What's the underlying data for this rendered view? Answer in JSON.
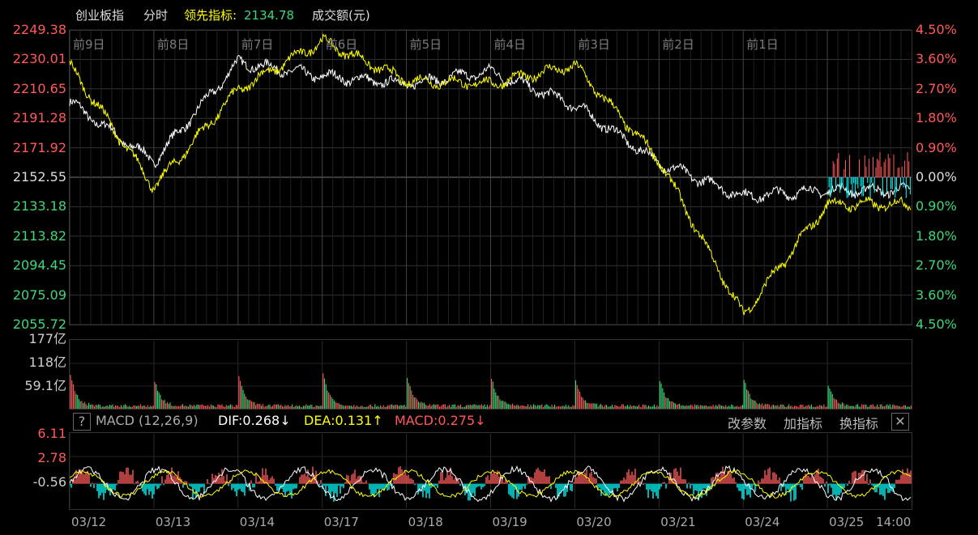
{
  "header": {
    "index_name": "创业板指",
    "mode": "分时",
    "lead_label": "领先指标:",
    "lead_value": "2134.78",
    "volume_label": "成交额(元)"
  },
  "colors": {
    "up": "#ff5a5a",
    "down": "#3fd77a",
    "price": "#ffffff",
    "lead": "#ffff00",
    "cyan": "#00ffff",
    "grid": "#333333",
    "dayline": "#444444"
  },
  "price_axis": {
    "left_ticks": [
      "2249.38",
      "2230.01",
      "2210.65",
      "2191.28",
      "2171.92",
      "2152.55",
      "2133.18",
      "2113.82",
      "2094.45",
      "2075.09",
      "2055.72"
    ],
    "right_ticks": [
      "4.50%",
      "3.60%",
      "2.70%",
      "1.80%",
      "0.90%",
      "0.00%",
      "0.90%",
      "1.80%",
      "2.70%",
      "3.60%",
      "4.50%"
    ]
  },
  "day_labels": [
    "前9日",
    "前8日",
    "前7日",
    "前6日",
    "前5日",
    "前4日",
    "前3日",
    "前2日",
    "前1日"
  ],
  "volume_axis": {
    "ticks": [
      "177亿",
      "118亿",
      "59.1亿"
    ]
  },
  "macd_header": {
    "help": "?",
    "name": "MACD (12,26,9)",
    "dif": "DIF:0.268↓",
    "dea": "DEA:0.131↑",
    "macd": "MACD:0.275↓",
    "btn_params": "改参数",
    "btn_add": "加指标",
    "btn_switch": "换指标",
    "btn_close": "✕"
  },
  "macd_axis": {
    "ticks": [
      "6.11",
      "2.78",
      "-0.56"
    ]
  },
  "date_labels": [
    "03/12",
    "03/13",
    "03/14",
    "03/17",
    "03/18",
    "03/19",
    "03/20",
    "03/21",
    "03/24",
    "03/25",
    "14:00"
  ],
  "chart_data": {
    "type": "line",
    "title": "创业板指 分时",
    "x": [
      "03/12",
      "03/13",
      "03/14",
      "03/17",
      "03/18",
      "03/19",
      "03/20",
      "03/21",
      "03/24",
      "03/25"
    ],
    "series": [
      {
        "name": "创业板指",
        "values": [
          2202.0,
          2163.0,
          2228.0,
          2219.0,
          2214.0,
          2222.0,
          2200.0,
          2162.0,
          2140.0,
          2144.0
        ]
      },
      {
        "name": "领先指标",
        "values": [
          2226.0,
          2146.0,
          2210.0,
          2242.0,
          2216.0,
          2214.0,
          2226.0,
          2164.0,
          2062.0,
          2134.78
        ]
      }
    ],
    "ylim": [
      2055.72,
      2249.38
    ],
    "volume": {
      "unit": "亿",
      "ylim": [
        0,
        177
      ],
      "daily_open_spike": [
        88,
        70,
        85,
        92,
        80,
        78,
        74,
        72,
        75,
        60
      ]
    },
    "macd": {
      "ylim": [
        -3.0,
        6.11
      ],
      "dif": 0.268,
      "dea": 0.131,
      "macd": 0.275
    }
  }
}
